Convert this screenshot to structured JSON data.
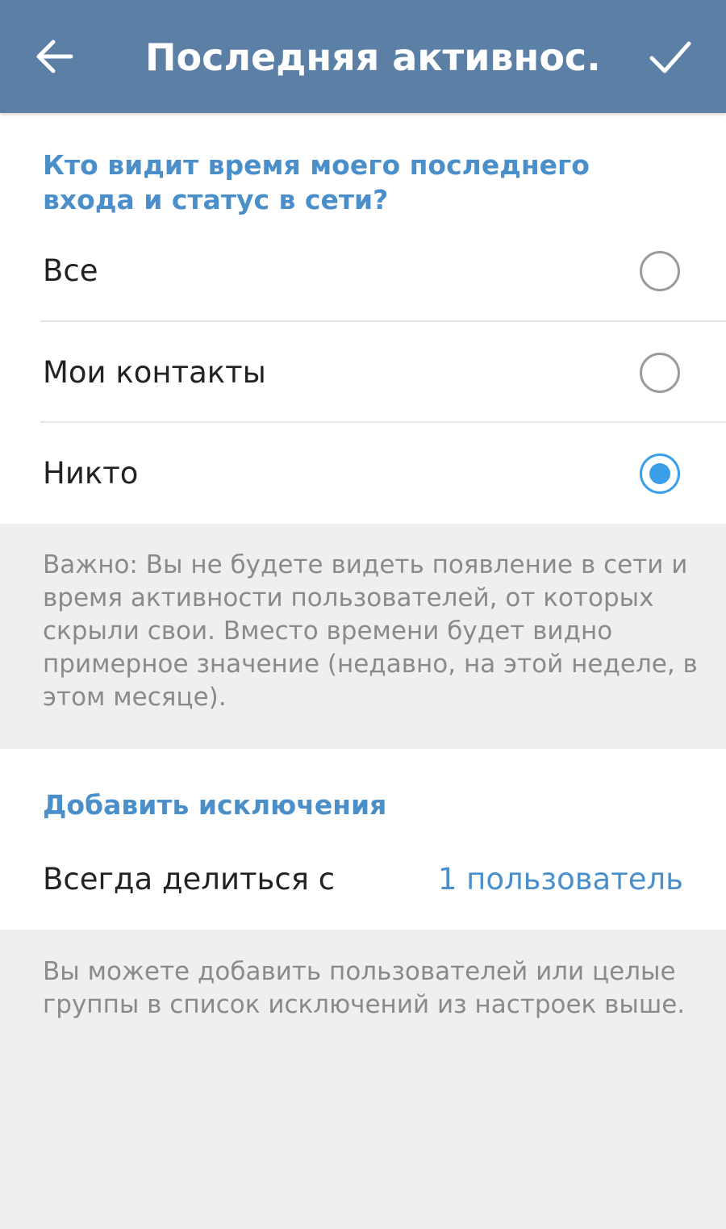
{
  "header": {
    "title": "Последняя активнос...",
    "back_icon": "arrow-left-icon",
    "confirm_icon": "check-icon"
  },
  "visibility": {
    "heading": "Кто видит время моего последнего входа и статус в сети?",
    "options": [
      {
        "label": "Все",
        "selected": false
      },
      {
        "label": "Мои контакты",
        "selected": false
      },
      {
        "label": "Никто",
        "selected": true
      }
    ],
    "note": "Важно: Вы не будете видеть появление в сети и время активности пользователей, от которых скрыли свои. Вместо времени будет видно примерное значение (недавно, на этой неделе, в этом месяце)."
  },
  "exceptions": {
    "heading": "Добавить исключения",
    "always_share_label": "Всегда делиться с",
    "always_share_value": "1 пользователь",
    "note": "Вы можете добавить пользователей или целые группы в список исключений из настроек выше."
  },
  "colors": {
    "appbar": "#5b7fa5",
    "accent": "#4a8fc9",
    "radio_active": "#3b9ee8",
    "background": "#efefef"
  }
}
